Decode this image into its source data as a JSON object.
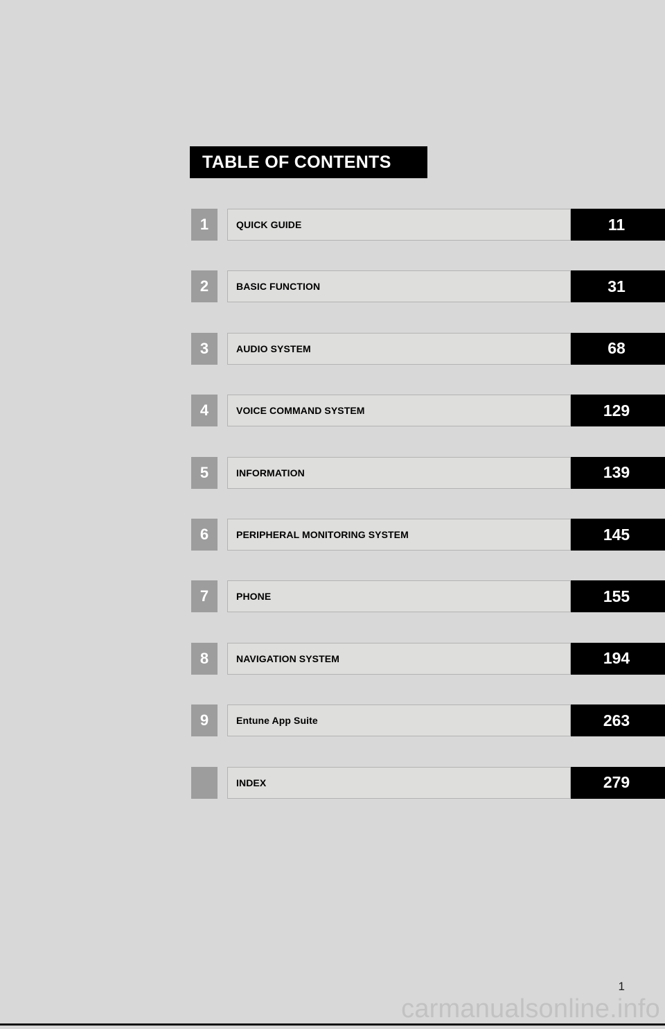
{
  "page": {
    "background_color": "#d8d8d8",
    "folio_number": "1",
    "watermark": "carmanualsonline.info"
  },
  "header": {
    "title": "TABLE OF CONTENTS",
    "background_color": "#000000",
    "text_color": "#ffffff"
  },
  "colors": {
    "number_box": "#9d9d9d",
    "title_box": "#dededc",
    "title_box_border": "#b3b3b3",
    "page_box": "#000000"
  },
  "toc": {
    "rows": [
      {
        "number": "1",
        "title": "QUICK GUIDE",
        "page": "11"
      },
      {
        "number": "2",
        "title": "BASIC FUNCTION",
        "page": "31"
      },
      {
        "number": "3",
        "title": "AUDIO SYSTEM",
        "page": "68"
      },
      {
        "number": "4",
        "title": "VOICE COMMAND SYSTEM",
        "page": "129"
      },
      {
        "number": "5",
        "title": "INFORMATION",
        "page": "139"
      },
      {
        "number": "6",
        "title": "PERIPHERAL MONITORING SYSTEM",
        "page": "145"
      },
      {
        "number": "7",
        "title": "PHONE",
        "page": "155"
      },
      {
        "number": "8",
        "title": "NAVIGATION SYSTEM",
        "page": "194"
      },
      {
        "number": "9",
        "title": "Entune App Suite",
        "page": "263"
      },
      {
        "number": "",
        "title": "INDEX",
        "page": "279"
      }
    ]
  }
}
